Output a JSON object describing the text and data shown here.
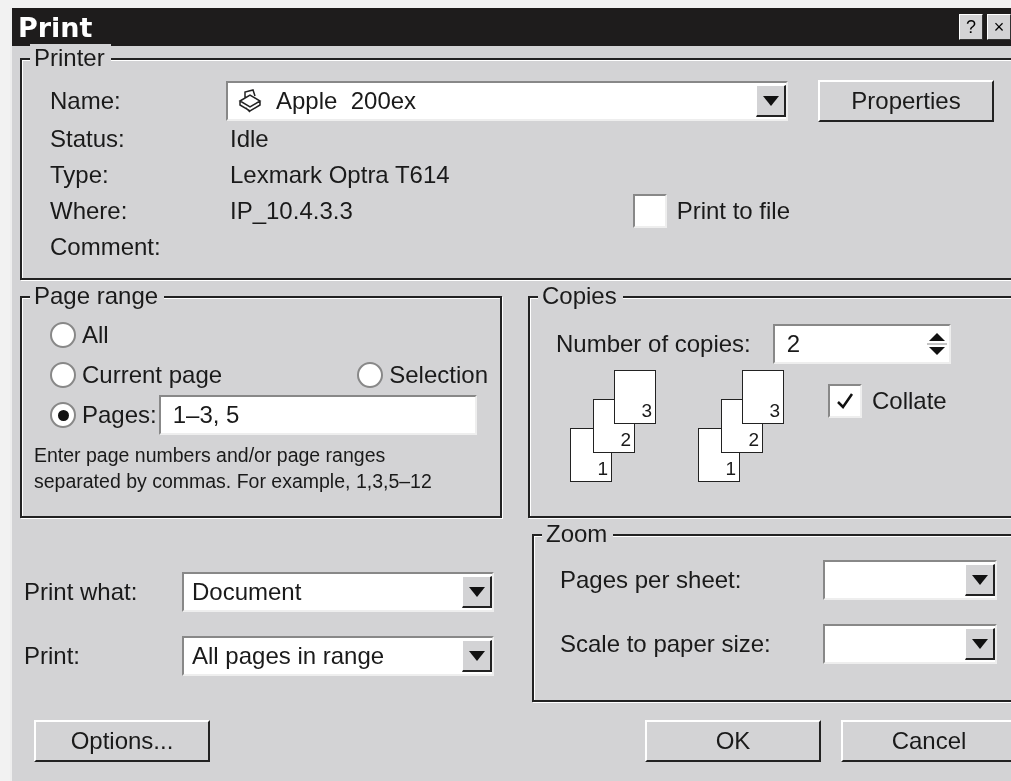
{
  "window": {
    "title": "Print",
    "title_buttons": [
      "?",
      "×"
    ]
  },
  "printer": {
    "legend": "Printer",
    "name": {
      "label": "Name:",
      "value": "Apple  200ex"
    },
    "properties_button": {
      "label": "Properties"
    },
    "info": [
      {
        "label": "Status:",
        "value": "Idle"
      },
      {
        "label": "Type:",
        "value": "Lexmark Optra T614"
      },
      {
        "label": "Where:",
        "value": "IP_10.4.3.3"
      },
      {
        "label": "Comment:"
      }
    ],
    "print_to_file": {
      "label": "Print to file",
      "checked": false
    }
  },
  "page_range": {
    "legend": "Page range",
    "options": [
      {
        "label": "All",
        "selected": false
      },
      {
        "label": "Current page",
        "selected": false
      },
      {
        "label": "Selection",
        "selected": false
      },
      {
        "label": "Pages:",
        "selected": true
      }
    ],
    "pages_value": "1–3, 5",
    "hint": "Enter page numbers and/or page ranges\nseparated by commas. For example, 1,3,5–12"
  },
  "copies": {
    "legend": "Copies",
    "number_label": "Number of copies:",
    "value": "2",
    "stacks": [
      [
        "1",
        "2",
        "3"
      ],
      [
        "1",
        "2",
        "3"
      ]
    ],
    "collate": {
      "label": "Collate",
      "checked": true
    }
  },
  "print_what": {
    "label": "Print what:",
    "value": "Document"
  },
  "print": {
    "label": "Print:",
    "value": "All pages in range"
  },
  "zoom": {
    "legend": "Zoom",
    "fields": [
      {
        "label": "Pages per sheet:"
      },
      {
        "label": "Scale to paper size:"
      }
    ]
  },
  "buttons": [
    {
      "label": "Options..."
    },
    {
      "label": "OK"
    },
    {
      "label": "Cancel"
    }
  ]
}
